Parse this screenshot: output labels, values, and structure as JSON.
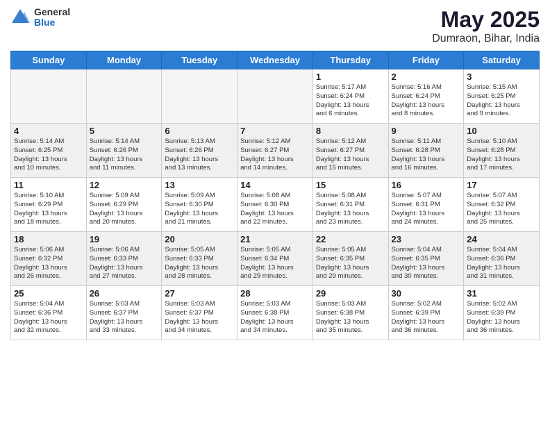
{
  "logo": {
    "general": "General",
    "blue": "Blue"
  },
  "header": {
    "month": "May 2025",
    "location": "Dumraon, Bihar, India"
  },
  "days": [
    "Sunday",
    "Monday",
    "Tuesday",
    "Wednesday",
    "Thursday",
    "Friday",
    "Saturday"
  ],
  "weeks": [
    [
      {
        "day": "",
        "text": ""
      },
      {
        "day": "",
        "text": ""
      },
      {
        "day": "",
        "text": ""
      },
      {
        "day": "",
        "text": ""
      },
      {
        "day": "1",
        "text": "Sunrise: 5:17 AM\nSunset: 6:24 PM\nDaylight: 13 hours\nand 6 minutes."
      },
      {
        "day": "2",
        "text": "Sunrise: 5:16 AM\nSunset: 6:24 PM\nDaylight: 13 hours\nand 8 minutes."
      },
      {
        "day": "3",
        "text": "Sunrise: 5:15 AM\nSunset: 6:25 PM\nDaylight: 13 hours\nand 9 minutes."
      }
    ],
    [
      {
        "day": "4",
        "text": "Sunrise: 5:14 AM\nSunset: 6:25 PM\nDaylight: 13 hours\nand 10 minutes."
      },
      {
        "day": "5",
        "text": "Sunrise: 5:14 AM\nSunset: 6:26 PM\nDaylight: 13 hours\nand 11 minutes."
      },
      {
        "day": "6",
        "text": "Sunrise: 5:13 AM\nSunset: 6:26 PM\nDaylight: 13 hours\nand 13 minutes."
      },
      {
        "day": "7",
        "text": "Sunrise: 5:12 AM\nSunset: 6:27 PM\nDaylight: 13 hours\nand 14 minutes."
      },
      {
        "day": "8",
        "text": "Sunrise: 5:12 AM\nSunset: 6:27 PM\nDaylight: 13 hours\nand 15 minutes."
      },
      {
        "day": "9",
        "text": "Sunrise: 5:11 AM\nSunset: 6:28 PM\nDaylight: 13 hours\nand 16 minutes."
      },
      {
        "day": "10",
        "text": "Sunrise: 5:10 AM\nSunset: 6:28 PM\nDaylight: 13 hours\nand 17 minutes."
      }
    ],
    [
      {
        "day": "11",
        "text": "Sunrise: 5:10 AM\nSunset: 6:29 PM\nDaylight: 13 hours\nand 18 minutes."
      },
      {
        "day": "12",
        "text": "Sunrise: 5:09 AM\nSunset: 6:29 PM\nDaylight: 13 hours\nand 20 minutes."
      },
      {
        "day": "13",
        "text": "Sunrise: 5:09 AM\nSunset: 6:30 PM\nDaylight: 13 hours\nand 21 minutes."
      },
      {
        "day": "14",
        "text": "Sunrise: 5:08 AM\nSunset: 6:30 PM\nDaylight: 13 hours\nand 22 minutes."
      },
      {
        "day": "15",
        "text": "Sunrise: 5:08 AM\nSunset: 6:31 PM\nDaylight: 13 hours\nand 23 minutes."
      },
      {
        "day": "16",
        "text": "Sunrise: 5:07 AM\nSunset: 6:31 PM\nDaylight: 13 hours\nand 24 minutes."
      },
      {
        "day": "17",
        "text": "Sunrise: 5:07 AM\nSunset: 6:32 PM\nDaylight: 13 hours\nand 25 minutes."
      }
    ],
    [
      {
        "day": "18",
        "text": "Sunrise: 5:06 AM\nSunset: 6:32 PM\nDaylight: 13 hours\nand 26 minutes."
      },
      {
        "day": "19",
        "text": "Sunrise: 5:06 AM\nSunset: 6:33 PM\nDaylight: 13 hours\nand 27 minutes."
      },
      {
        "day": "20",
        "text": "Sunrise: 5:05 AM\nSunset: 6:33 PM\nDaylight: 13 hours\nand 28 minutes."
      },
      {
        "day": "21",
        "text": "Sunrise: 5:05 AM\nSunset: 6:34 PM\nDaylight: 13 hours\nand 29 minutes."
      },
      {
        "day": "22",
        "text": "Sunrise: 5:05 AM\nSunset: 6:35 PM\nDaylight: 13 hours\nand 29 minutes."
      },
      {
        "day": "23",
        "text": "Sunrise: 5:04 AM\nSunset: 6:35 PM\nDaylight: 13 hours\nand 30 minutes."
      },
      {
        "day": "24",
        "text": "Sunrise: 5:04 AM\nSunset: 6:36 PM\nDaylight: 13 hours\nand 31 minutes."
      }
    ],
    [
      {
        "day": "25",
        "text": "Sunrise: 5:04 AM\nSunset: 6:36 PM\nDaylight: 13 hours\nand 32 minutes."
      },
      {
        "day": "26",
        "text": "Sunrise: 5:03 AM\nSunset: 6:37 PM\nDaylight: 13 hours\nand 33 minutes."
      },
      {
        "day": "27",
        "text": "Sunrise: 5:03 AM\nSunset: 6:37 PM\nDaylight: 13 hours\nand 34 minutes."
      },
      {
        "day": "28",
        "text": "Sunrise: 5:03 AM\nSunset: 6:38 PM\nDaylight: 13 hours\nand 34 minutes."
      },
      {
        "day": "29",
        "text": "Sunrise: 5:03 AM\nSunset: 6:38 PM\nDaylight: 13 hours\nand 35 minutes."
      },
      {
        "day": "30",
        "text": "Sunrise: 5:02 AM\nSunset: 6:39 PM\nDaylight: 13 hours\nand 36 minutes."
      },
      {
        "day": "31",
        "text": "Sunrise: 5:02 AM\nSunset: 6:39 PM\nDaylight: 13 hours\nand 36 minutes."
      }
    ]
  ]
}
